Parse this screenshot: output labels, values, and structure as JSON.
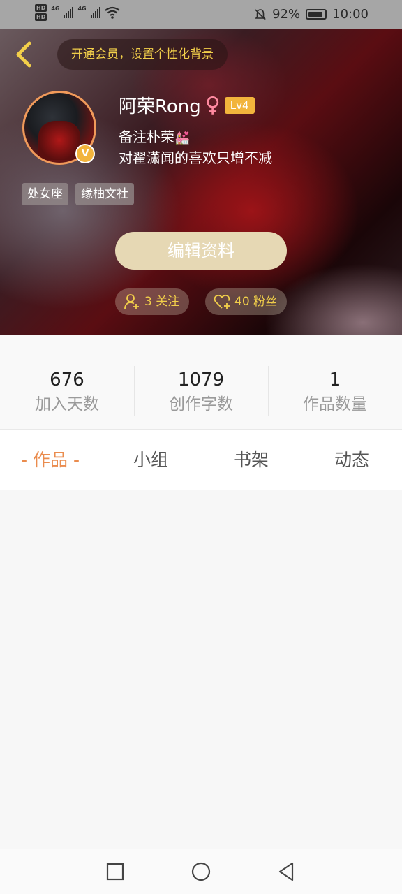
{
  "status_bar": {
    "left_hd1": "HD",
    "left_hd2": "HD",
    "net1": "4G",
    "net2": "4G",
    "battery": "92%",
    "time": "10:00"
  },
  "header": {
    "vip_prompt": "开通会员，设置个性化背景",
    "name": "阿荣Rong",
    "gender_symbol": "♀",
    "level": "Lv4",
    "verified_badge": "V",
    "bio_line1": "备注朴荣",
    "bio_emoji": "💒",
    "bio_line2": "对翟潇闻的喜欢只增不减",
    "tags": [
      "处女座",
      "缘柚文社"
    ],
    "edit_button": "编辑资料",
    "follow_text": "3 关注",
    "fans_text": "40 粉丝"
  },
  "stats": [
    {
      "value": "676",
      "label": "加入天数"
    },
    {
      "value": "1079",
      "label": "创作字数"
    },
    {
      "value": "1",
      "label": "作品数量"
    }
  ],
  "tabs": [
    {
      "label": "- 作品 -",
      "active": true
    },
    {
      "label": "小组",
      "active": false
    },
    {
      "label": "书架",
      "active": false
    },
    {
      "label": "动态",
      "active": false
    }
  ],
  "colors": {
    "accent": "#ea8c4e",
    "gold": "#f2cf4a",
    "level_badge": "#f2b43c",
    "edit_button": "#e6d8b4"
  }
}
